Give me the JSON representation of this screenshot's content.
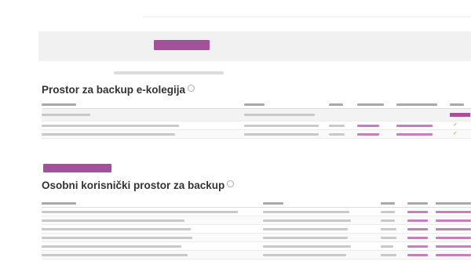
{
  "header": {},
  "upload": {
    "button_label": ""
  },
  "info_note": "",
  "colors": {
    "accent": "#a4509a",
    "link": "#c67fbd",
    "check": "#8ab73a"
  },
  "course_backup": {
    "title": "Prostor za backup e-kolegija",
    "help_icon": "question-circle-icon",
    "columns": [
      "",
      "",
      "",
      "",
      "",
      ""
    ],
    "rows": [
      {
        "cells": [
          "",
          "",
          "",
          "",
          "",
          ""
        ],
        "action": "restore-button"
      },
      {
        "cells": [
          "",
          "",
          "",
          "",
          "",
          ""
        ],
        "action": "check-icon"
      },
      {
        "cells": [
          "",
          "",
          "",
          "",
          "",
          ""
        ],
        "action": "check-icon"
      }
    ],
    "save_button_label": ""
  },
  "personal_backup": {
    "title": "Osobni korisnički prostor za backup",
    "help_icon": "question-circle-icon",
    "columns": [
      "",
      "",
      "",
      "",
      ""
    ],
    "rows": [
      {
        "cells": [
          "",
          "",
          "",
          "",
          ""
        ]
      },
      {
        "cells": [
          "",
          "",
          "",
          "",
          ""
        ]
      },
      {
        "cells": [
          "",
          "",
          "",
          "",
          ""
        ]
      },
      {
        "cells": [
          "",
          "",
          "",
          "",
          ""
        ]
      },
      {
        "cells": [
          "",
          "",
          "",
          "",
          ""
        ]
      },
      {
        "cells": [
          "",
          "",
          "",
          "",
          ""
        ]
      },
      {
        "cells": [
          "",
          "",
          "",
          "",
          ""
        ]
      }
    ]
  }
}
